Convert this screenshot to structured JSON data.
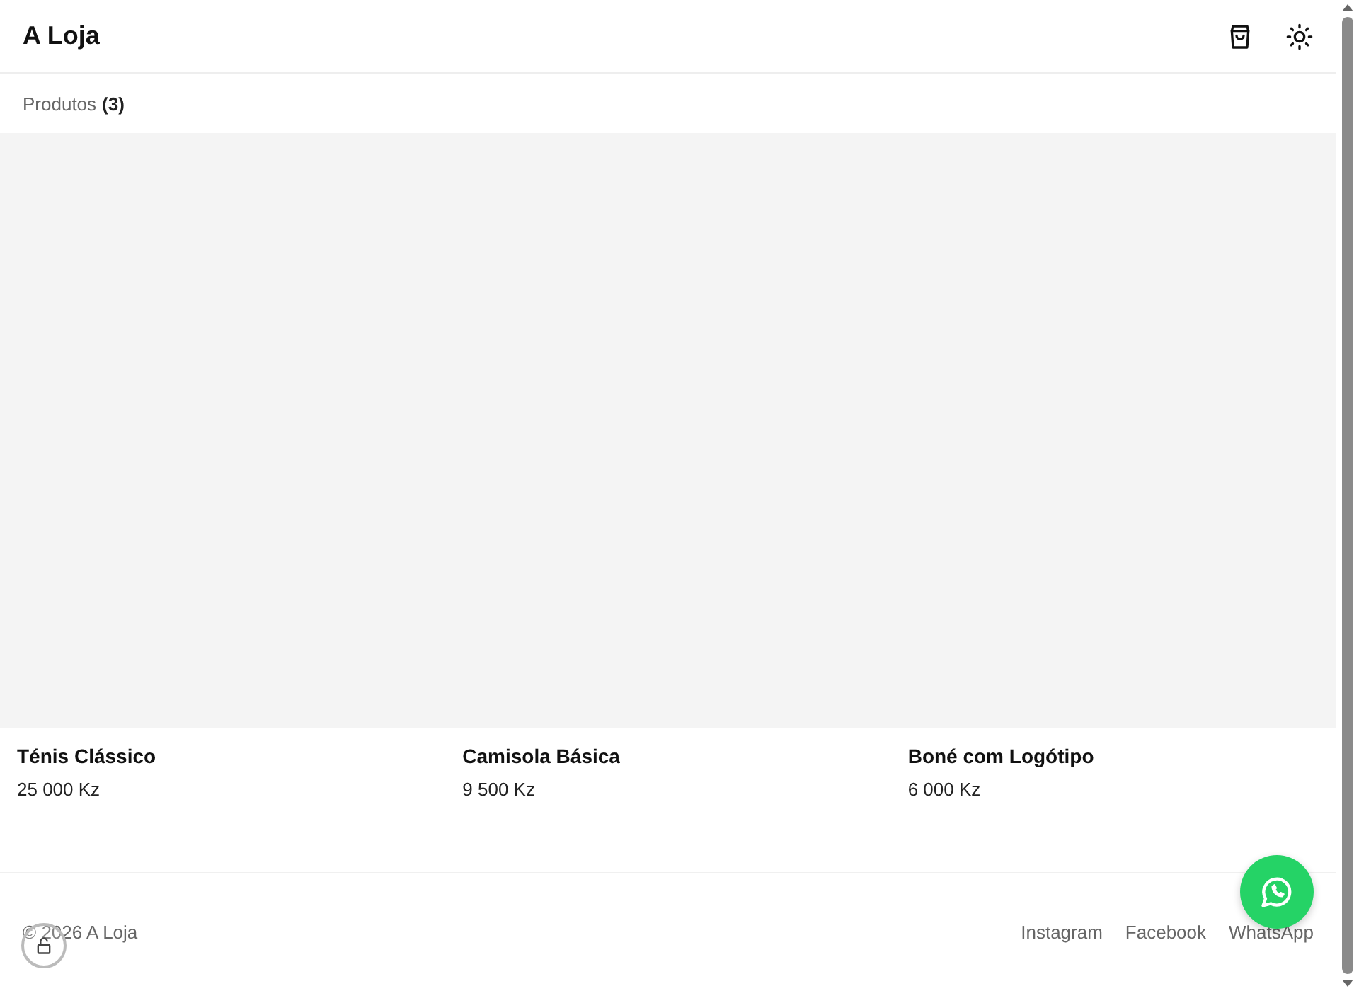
{
  "header": {
    "title": "A Loja"
  },
  "section": {
    "label": "Produtos",
    "count": "(3)"
  },
  "products": [
    {
      "name": "Ténis Clássico",
      "price": "25 000 Kz"
    },
    {
      "name": "Camisola Básica",
      "price": "9 500 Kz"
    },
    {
      "name": "Boné com Logótipo",
      "price": "6 000 Kz"
    }
  ],
  "footer": {
    "copyright": "© 2026 A Loja",
    "links": [
      "Instagram",
      "Facebook",
      "WhatsApp"
    ]
  }
}
